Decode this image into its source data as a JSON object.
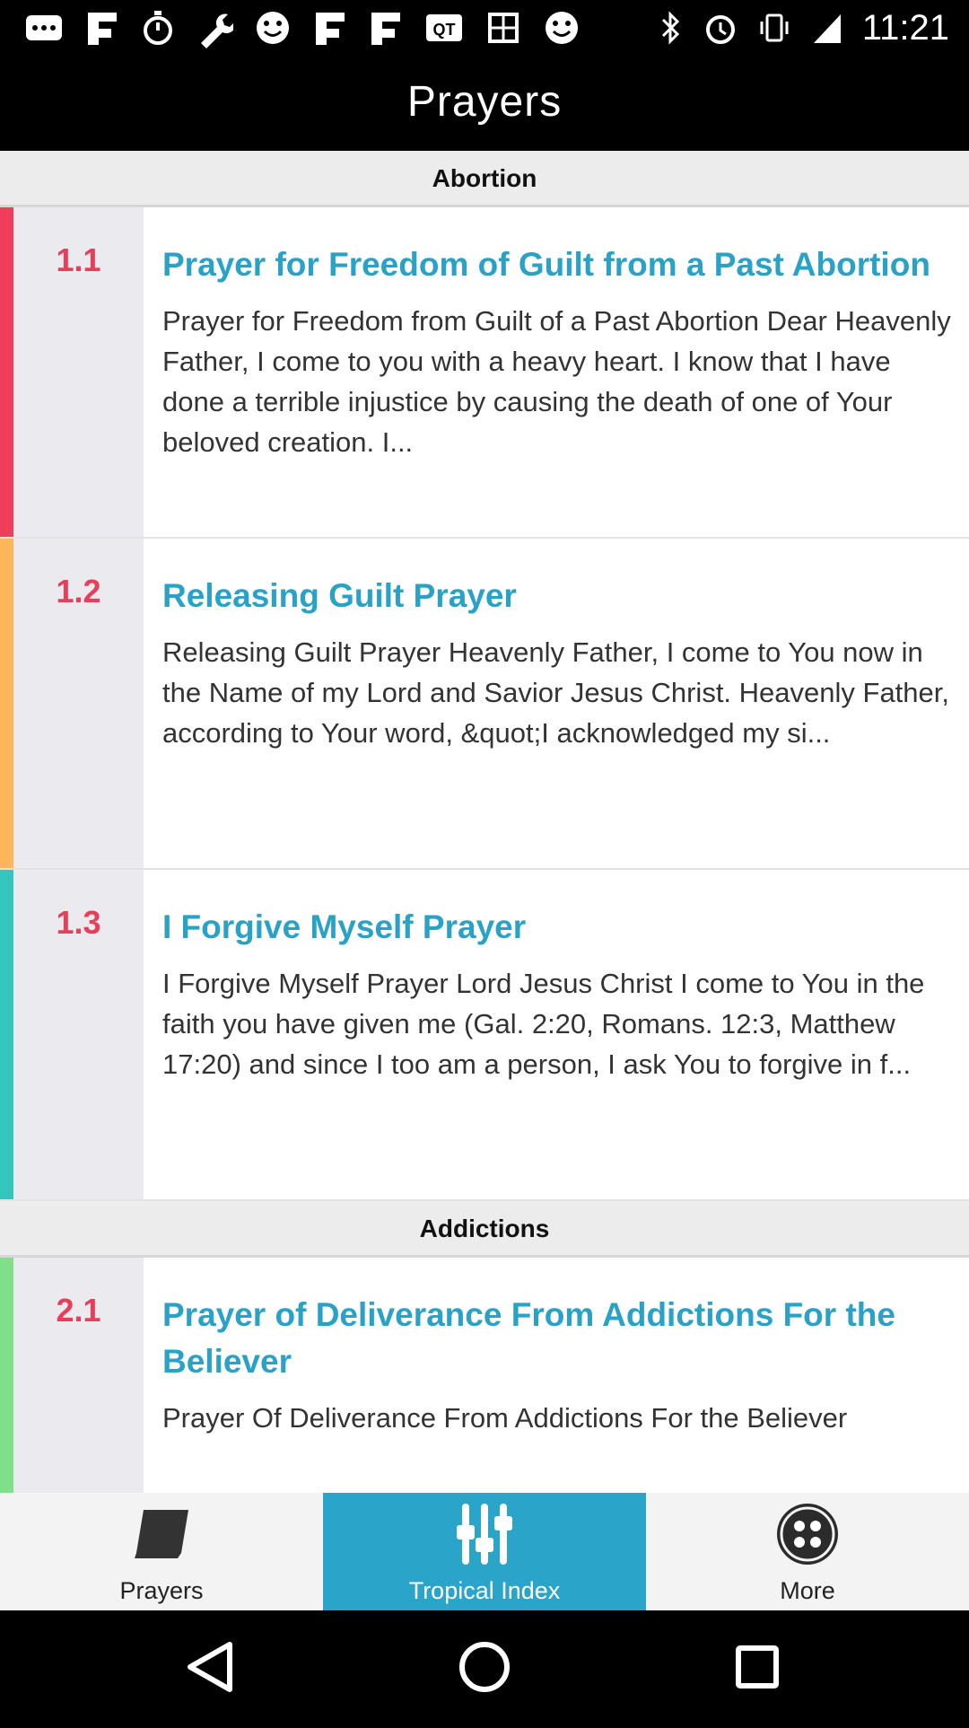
{
  "status_bar": {
    "notification_icons": [
      "messenger-dots-icon",
      "flipboard-icon",
      "stopwatch-icon",
      "wrench-icon",
      "smiley-icon",
      "flipboard-icon",
      "flipboard-icon",
      "qt-icon",
      "grid-app-icon",
      "smiley-icon"
    ],
    "system_icons": [
      "bluetooth-icon",
      "alarm-icon",
      "vibrate-icon",
      "signal-icon"
    ],
    "time": "11:21"
  },
  "app_bar": {
    "title": "Prayers"
  },
  "sections": [
    {
      "header": "Abortion",
      "entries": [
        {
          "number": "1.1",
          "title": "Prayer for Freedom of Guilt from a Past Abortion",
          "text": "Prayer for Freedom from Guilt of a Past Abortion Dear Heavenly Father, I come to you with a heavy heart.  I know that I have done a terrible injustice by causing the death of one of Your beloved creation.  I...",
          "accent": "#ee3e5a"
        },
        {
          "number": "1.2",
          "title": "Releasing Guilt Prayer",
          "text": "Releasing Guilt Prayer Heavenly Father, I come to You now in the Name of my Lord and Savior Jesus Christ. Heavenly Father, according to Your word, &quot;I acknowledged my si...",
          "accent": "#ffb55a"
        },
        {
          "number": "1.3",
          "title": "I Forgive Myself Prayer",
          "text": "I Forgive Myself Prayer Lord Jesus Christ I come to You in the faith you have given me (Gal. 2:20, Romans. 12:3, Matthew 17:20) and since I too am a person, I ask You to forgive in f...",
          "accent": "#36c5bd"
        }
      ]
    },
    {
      "header": "Addictions",
      "entries": [
        {
          "number": "2.1",
          "title": "Prayer of Deliverance From Addictions For the Believer",
          "text": "Prayer Of Deliverance From Addictions For the Believer",
          "accent": "#7fe08a"
        }
      ]
    }
  ],
  "tabs": [
    {
      "label": "Prayers",
      "icon": "book-icon",
      "active": false
    },
    {
      "label": "Tropical Index",
      "icon": "sliders-icon",
      "active": true
    },
    {
      "label": "More",
      "icon": "more-dots-icon",
      "active": false
    }
  ],
  "nav_buttons": [
    "back-icon",
    "home-icon",
    "recents-icon"
  ]
}
